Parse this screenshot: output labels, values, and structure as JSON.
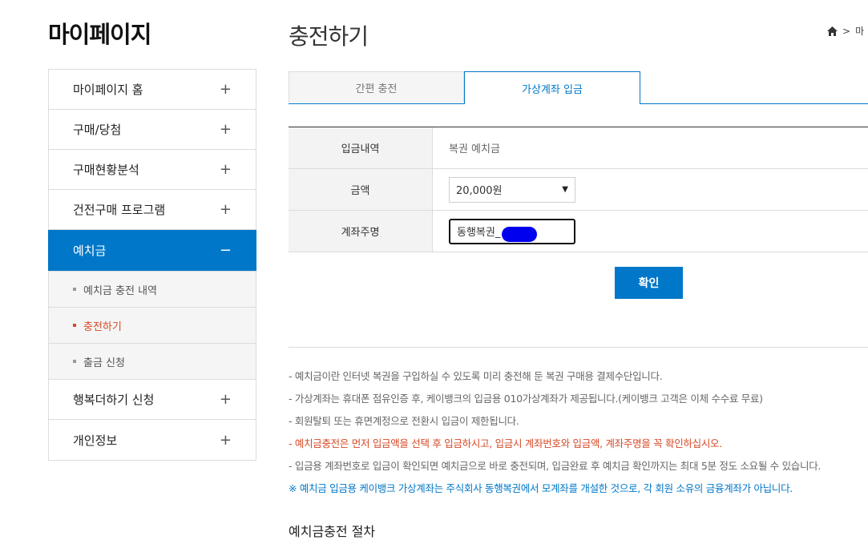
{
  "sidebar": {
    "title": "마이페이지",
    "items": [
      {
        "label": "마이페이지 홈",
        "sign": "+"
      },
      {
        "label": "구매/당첨",
        "sign": "+"
      },
      {
        "label": "구매현황분석",
        "sign": "+"
      },
      {
        "label": "건전구매 프로그램",
        "sign": "+"
      },
      {
        "label": "예치금",
        "sign": "−"
      }
    ],
    "subitems": [
      {
        "label": "예치금 충전 내역"
      },
      {
        "label": "충전하기"
      },
      {
        "label": "출금 신청"
      }
    ],
    "items_after": [
      {
        "label": "행복더하기 신청",
        "sign": "+"
      },
      {
        "label": "개인정보",
        "sign": "+"
      }
    ]
  },
  "header": {
    "title": "충전하기",
    "breadcrumb_sep": ">",
    "breadcrumb_text": "마",
    "home_icon": "home-icon"
  },
  "tabs": [
    {
      "label": "간편 충전"
    },
    {
      "label": "가상계좌 입금"
    }
  ],
  "form": {
    "rows": [
      {
        "label": "입금내역",
        "value": "복권 예치금"
      },
      {
        "label": "금액",
        "value": "20,000원",
        "arrow": "▼"
      },
      {
        "label": "계좌주명",
        "value": "동행복권_"
      }
    ],
    "confirm_label": "확인"
  },
  "notes": [
    "-  예치금이란 인터넷 복권을 구입하실 수 있도록 미리 충전해 둔 복권 구매용 결제수단입니다.",
    "-  가상계좌는 휴대폰 점유인증 후, 케이뱅크의 입금용 010가상계좌가 제공됩니다.(케이뱅크 고객은 이체 수수료 무료)",
    "-  회원탈퇴 또는 휴면계정으로 전환시 입금이 제한됩니다.",
    "-  예치금충전은 먼저 입금액을 선택 후 입금하시고, 입금시 계좌번호와 입금액, 계좌주명을 꼭 확인하십시오.",
    "-  입금용 계좌번호로 입금이 확인되면 예치금으로 바로 충전되며, 입금완료 후 예치금 확인까지는 최대 5분 정도 소요될 수 있습니다.",
    "※ 예치금 입금용 케이뱅크 가상계좌는 주식회사 동행복권에서 모계좌를 개설한 것으로, 각 회원 소유의 금융계좌가 아닙니다."
  ],
  "procedure_title": "예치금충전 절차",
  "colors": {
    "accent": "#0077c8",
    "highlight": "#d64a27"
  }
}
